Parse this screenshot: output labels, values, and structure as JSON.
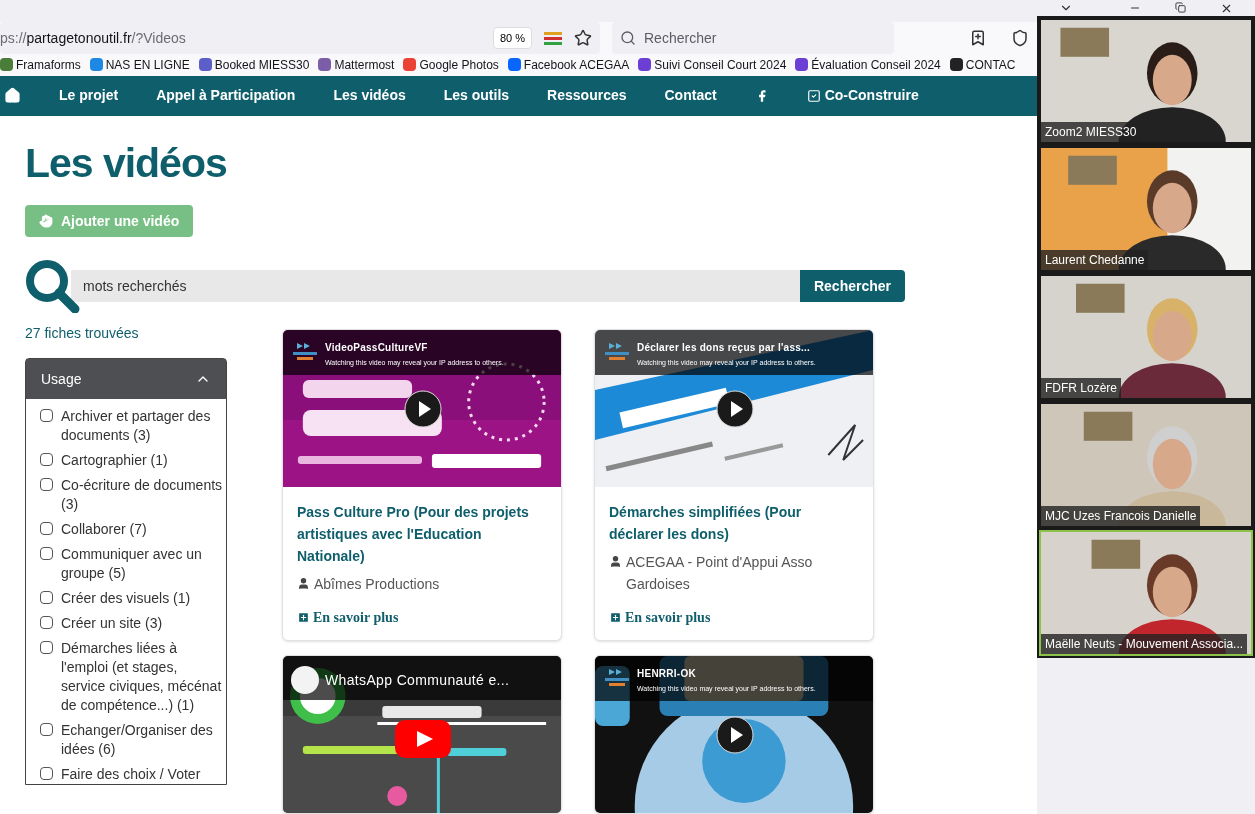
{
  "browser": {
    "url_scheme": "ps://",
    "url_host": "partagetonoutil.fr",
    "url_path": "/?Videos",
    "zoom": "80 %",
    "search_placeholder": "Rechercher"
  },
  "bookmarks": [
    {
      "label": "Framaforms"
    },
    {
      "label": "NAS EN LIGNE"
    },
    {
      "label": "Booked MIESS30"
    },
    {
      "label": "Mattermost"
    },
    {
      "label": "Google Photos"
    },
    {
      "label": "Facebook ACEGAA"
    },
    {
      "label": "Suivi Conseil Court 2024"
    },
    {
      "label": "Évaluation Conseil 2024"
    },
    {
      "label": "CONTAC"
    }
  ],
  "nav": {
    "items": [
      {
        "label": "Le projet"
      },
      {
        "label": "Appel à Participation"
      },
      {
        "label": "Les vidéos"
      },
      {
        "label": "Les outils"
      },
      {
        "label": "Ressources"
      },
      {
        "label": "Contact"
      }
    ],
    "extra": "Co-Construire"
  },
  "page": {
    "title": "Les vidéos",
    "add_button": "Ajouter une vidéo",
    "search_placeholder": "mots recherchés",
    "search_button": "Rechercher",
    "count": "27 fiches trouvées"
  },
  "filter": {
    "title": "Usage",
    "expanded": true,
    "options": [
      {
        "label": "Archiver et partager des documents (3)",
        "checked": false
      },
      {
        "label": "Cartographier (1)",
        "checked": false
      },
      {
        "label": "Co-écriture de documents (3)",
        "checked": false
      },
      {
        "label": "Collaborer (7)",
        "checked": false
      },
      {
        "label": "Communiquer avec un groupe (5)",
        "checked": false
      },
      {
        "label": "Créer des visuels (1)",
        "checked": false
      },
      {
        "label": "Créer un site (3)",
        "checked": false
      },
      {
        "label": "Démarches liées à l'emploi (et stages, service civiques, mécénat de compétence...) (1)",
        "checked": false
      },
      {
        "label": "Echanger/Organiser des idées (6)",
        "checked": false
      },
      {
        "label": "Faire des choix / Voter",
        "checked": false
      }
    ]
  },
  "cards": [
    {
      "video_title": "VideoPassCultureVF",
      "video_note": "Watching this video may reveal your IP address to others.",
      "kind": "round",
      "title": "Pass Culture Pro (Pour des projets artistiques avec l'Education Nationale)",
      "author": "Abîmes Productions",
      "link": "En savoir plus"
    },
    {
      "video_title": "Déclarer les dons reçus par l'ass...",
      "video_note": "Watching this video may reveal your IP address to others.",
      "kind": "round",
      "title": "Démarches simplifiées (Pour déclarer les dons)",
      "author": "ACEGAA - Point d'Appui Asso Gardoises",
      "link": "En savoir plus"
    },
    {
      "video_title": "WhatsApp Communauté e...",
      "kind": "red"
    },
    {
      "video_title": "HENRRI-OK",
      "video_note": "Watching this video may reveal your IP address to others.",
      "kind": "round"
    }
  ],
  "meeting": {
    "participants": [
      {
        "name": "Zoom2 MIESS30",
        "speaking": false
      },
      {
        "name": "Laurent Chedanne",
        "speaking": false
      },
      {
        "name": "FDFR Lozère",
        "speaking": false
      },
      {
        "name": "MJC Uzes Francois Danielle",
        "speaking": false
      },
      {
        "name": "Maëlle Neuts - Mouvement Associa...",
        "speaking": true
      }
    ]
  }
}
